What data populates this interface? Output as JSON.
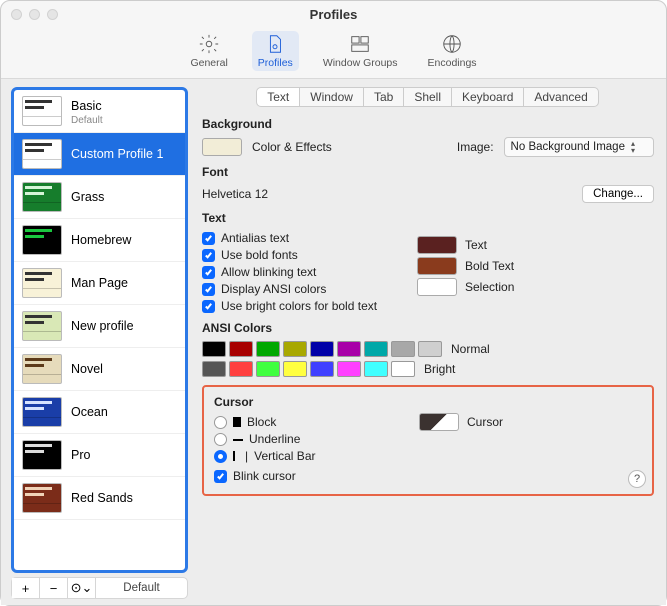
{
  "window": {
    "title": "Profiles"
  },
  "toolbar": {
    "items": [
      {
        "label": "General"
      },
      {
        "label": "Profiles"
      },
      {
        "label": "Window Groups"
      },
      {
        "label": "Encodings"
      }
    ]
  },
  "sidebar": {
    "items": [
      {
        "name": "Basic",
        "subtitle": "Default",
        "thumb_bg": "#ffffff",
        "thumb_fg": "#333"
      },
      {
        "name": "Custom Profile 1",
        "subtitle": "",
        "thumb_bg": "#ffffff",
        "thumb_fg": "#333"
      },
      {
        "name": "Grass",
        "subtitle": "",
        "thumb_bg": "#167d2c",
        "thumb_fg": "#d6f5d8"
      },
      {
        "name": "Homebrew",
        "subtitle": "",
        "thumb_bg": "#000000",
        "thumb_fg": "#1ac73f"
      },
      {
        "name": "Man Page",
        "subtitle": "",
        "thumb_bg": "#f8f2d8",
        "thumb_fg": "#333"
      },
      {
        "name": "New profile",
        "subtitle": "",
        "thumb_bg": "#d9e8b6",
        "thumb_fg": "#333"
      },
      {
        "name": "Novel",
        "subtitle": "",
        "thumb_bg": "#e6dbbb",
        "thumb_fg": "#5c3a1a"
      },
      {
        "name": "Ocean",
        "subtitle": "",
        "thumb_bg": "#1a3ea8",
        "thumb_fg": "#d6e3ff"
      },
      {
        "name": "Pro",
        "subtitle": "",
        "thumb_bg": "#000000",
        "thumb_fg": "#dcdcdc"
      },
      {
        "name": "Red Sands",
        "subtitle": "",
        "thumb_bg": "#7b2c19",
        "thumb_fg": "#f0d3b8"
      }
    ],
    "selected_index": 1,
    "footer": {
      "add": "+",
      "remove": "−",
      "menu": "⊙⌄",
      "default_label": "Default"
    }
  },
  "tabs": {
    "items": [
      "Text",
      "Window",
      "Tab",
      "Shell",
      "Keyboard",
      "Advanced"
    ],
    "active_index": 0
  },
  "background": {
    "title": "Background",
    "color_effects_label": "Color & Effects",
    "color_swatch": "#f2edd7",
    "image_label": "Image:",
    "image_value": "No Background Image"
  },
  "font": {
    "title": "Font",
    "current": "Helvetica 12",
    "change_label": "Change..."
  },
  "text_section": {
    "title": "Text",
    "options": [
      {
        "label": "Antialias text",
        "checked": true
      },
      {
        "label": "Use bold fonts",
        "checked": true
      },
      {
        "label": "Allow blinking text",
        "checked": true
      },
      {
        "label": "Display ANSI colors",
        "checked": true
      },
      {
        "label": "Use bright colors for bold text",
        "checked": true
      }
    ],
    "color_labels": {
      "text": "Text",
      "bold": "Bold Text",
      "selection": "Selection"
    },
    "text_color": "#5a2120",
    "bold_color": "#8a3b1d",
    "selection_color": "#ffffff"
  },
  "ansi": {
    "title": "ANSI Colors",
    "normal_label": "Normal",
    "bright_label": "Bright",
    "normal_disabled": "#cfcfcf",
    "normal": [
      "#000000",
      "#a80000",
      "#00a800",
      "#a8a800",
      "#0000a8",
      "#a800a8",
      "#00a8a8",
      "#a8a8a8"
    ],
    "bright": [
      "#555555",
      "#ff4040",
      "#40ff40",
      "#ffff40",
      "#4040ff",
      "#ff40ff",
      "#40ffff",
      "#ffffff"
    ]
  },
  "cursor": {
    "title": "Cursor",
    "options": [
      {
        "label": "Block",
        "selected": false,
        "kind": "block"
      },
      {
        "label": "Underline",
        "selected": false,
        "kind": "underline"
      },
      {
        "label": "Vertical Bar",
        "selected": true,
        "kind": "vbar"
      }
    ],
    "blink_label": "Blink cursor",
    "blink_checked": true,
    "swatch_label": "Cursor",
    "swatch_color": "#3b3230"
  },
  "help": "?"
}
